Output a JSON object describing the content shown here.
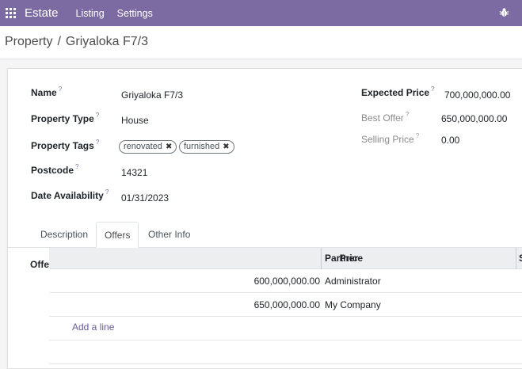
{
  "navbar": {
    "brand": "Estate",
    "menu": [
      "Listing",
      "Settings"
    ]
  },
  "breadcrumb": {
    "parent": "Property",
    "separator": "/",
    "current": "Griyaloka F7/3"
  },
  "form": {
    "name_label": "Name",
    "name_value": "Griyaloka F7/3",
    "property_type_label": "Property Type",
    "property_type_value": "House",
    "property_tags_label": "Property Tags",
    "tags": [
      "renovated",
      "furnished"
    ],
    "postcode_label": "Postcode",
    "postcode_value": "14321",
    "date_availability_label": "Date Availability",
    "date_availability_value": "01/31/2023",
    "expected_price_label": "Expected Price",
    "expected_price_value": "700,000,000.00",
    "best_offer_label": "Best Offer",
    "best_offer_value": "650,000,000.00",
    "selling_price_label": "Selling Price",
    "selling_price_value": "0.00",
    "help_mark": "?"
  },
  "tabs": {
    "items": [
      "Description",
      "Offers",
      "Other Info"
    ],
    "active": "Offers"
  },
  "offers": {
    "field_label": "Offe",
    "columns": {
      "price": "Price",
      "partner": "Partner",
      "status": "S"
    },
    "rows": [
      {
        "price": "600,000,000.00",
        "partner": "Administrator"
      },
      {
        "price": "650,000,000.00",
        "partner": "My Company"
      }
    ],
    "add_line": "Add a line"
  },
  "colors": {
    "navbar": "#7c6aa3",
    "header_row": "#eceef0"
  }
}
